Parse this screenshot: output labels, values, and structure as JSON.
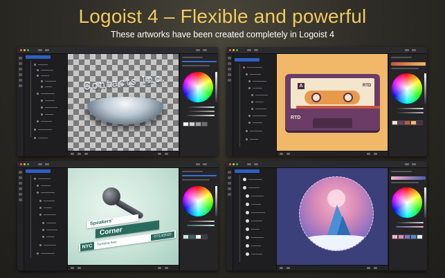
{
  "header": {
    "title": "Logoist 4 – Flexible and powerful",
    "subtitle": "These artworks have been created completely in Logoist 4"
  },
  "artworks": [
    {
      "id": "contacts",
      "text": "Contacts Inc."
    },
    {
      "id": "cassette",
      "badge_letter": "A",
      "label_top": "RTD",
      "label_bottom": "RTD"
    },
    {
      "id": "speakers",
      "line1": "Speakers'",
      "line2": "Corner",
      "city": "NYC",
      "street": "Tomkins Ave.",
      "date": "07/14/2020"
    },
    {
      "id": "wolf"
    }
  ],
  "colors": {
    "headline": "#f2cb5e",
    "layer_highlight": "#2f5fc4",
    "cassette_bg": "#f0b868",
    "speakers_accent": "#2a6b5f",
    "wolf_bg": "#3b3f7a"
  }
}
